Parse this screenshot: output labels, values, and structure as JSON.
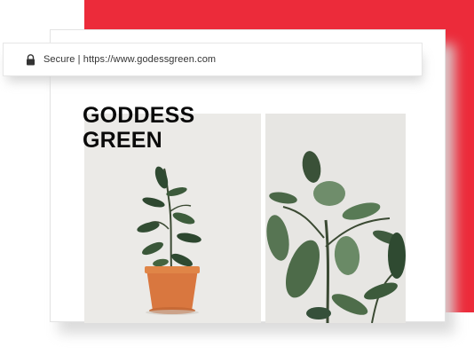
{
  "browser": {
    "security_label": "Secure",
    "separator": "|",
    "url": "https://www.godessgreen.com",
    "lock_icon": "lock-icon"
  },
  "site": {
    "brand_line1": "GODDESS",
    "brand_line2": "GREEN"
  },
  "colors": {
    "accent_red": "#ec2b3a",
    "pot": "#d9773f",
    "leaf_dark": "#3f5a3e",
    "leaf_light": "#6a8a66"
  }
}
